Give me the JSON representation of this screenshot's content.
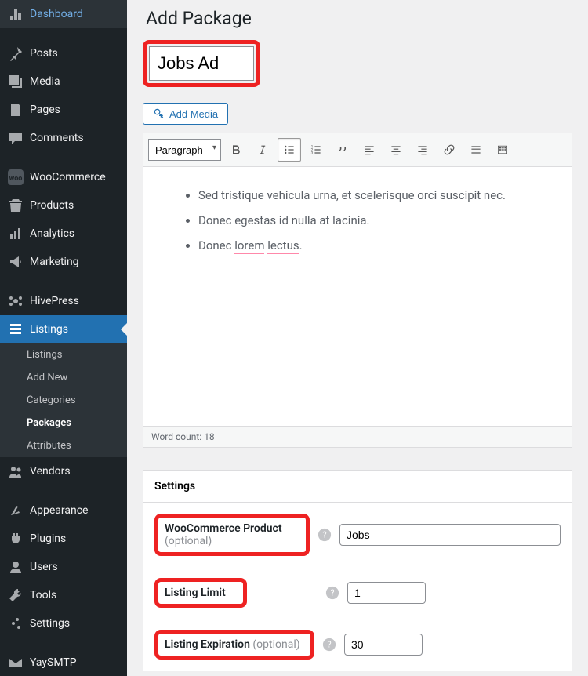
{
  "sidebar": {
    "items": [
      {
        "icon": "dashboard",
        "label": "Dashboard"
      },
      {
        "sep": true
      },
      {
        "icon": "pin",
        "label": "Posts"
      },
      {
        "icon": "media",
        "label": "Media"
      },
      {
        "icon": "page",
        "label": "Pages"
      },
      {
        "icon": "comment",
        "label": "Comments"
      },
      {
        "sep": true
      },
      {
        "icon": "woo",
        "label": "WooCommerce"
      },
      {
        "icon": "product",
        "label": "Products"
      },
      {
        "icon": "analytics",
        "label": "Analytics"
      },
      {
        "icon": "marketing",
        "label": "Marketing"
      },
      {
        "sep": true
      },
      {
        "icon": "hive",
        "label": "HivePress"
      },
      {
        "icon": "listings",
        "label": "Listings",
        "active": true
      },
      {
        "icon": "vendors",
        "label": "Vendors"
      },
      {
        "sep": true
      },
      {
        "icon": "appearance",
        "label": "Appearance"
      },
      {
        "icon": "plugins",
        "label": "Plugins"
      },
      {
        "icon": "users",
        "label": "Users"
      },
      {
        "icon": "tools",
        "label": "Tools"
      },
      {
        "icon": "settings",
        "label": "Settings"
      },
      {
        "sep": true
      },
      {
        "icon": "mail",
        "label": "YaySMTP"
      }
    ],
    "submenu": [
      "Listings",
      "Add New",
      "Categories",
      "Packages",
      "Attributes"
    ],
    "submenu_current": "Packages"
  },
  "page": {
    "title": "Add Package",
    "title_input": "Jobs Ad",
    "add_media": "Add Media",
    "para_select": "Paragraph",
    "content_items": [
      "Sed tristique vehicula urna, et scelerisque orci suscipit nec.",
      "Donec egestas id nulla at lacinia.",
      "Donec <err>lorem</err> <err>lectus</err>."
    ],
    "word_count_label": "Word count: ",
    "word_count": "18"
  },
  "settings": {
    "header": "Settings",
    "woocommerce_label": "WooCommerce Product",
    "optional_text": "(optional)",
    "woocommerce_value": "Jobs",
    "listing_limit_label": "Listing Limit",
    "listing_limit_value": "1",
    "listing_exp_label": "Listing Expiration",
    "listing_exp_value": "30"
  }
}
